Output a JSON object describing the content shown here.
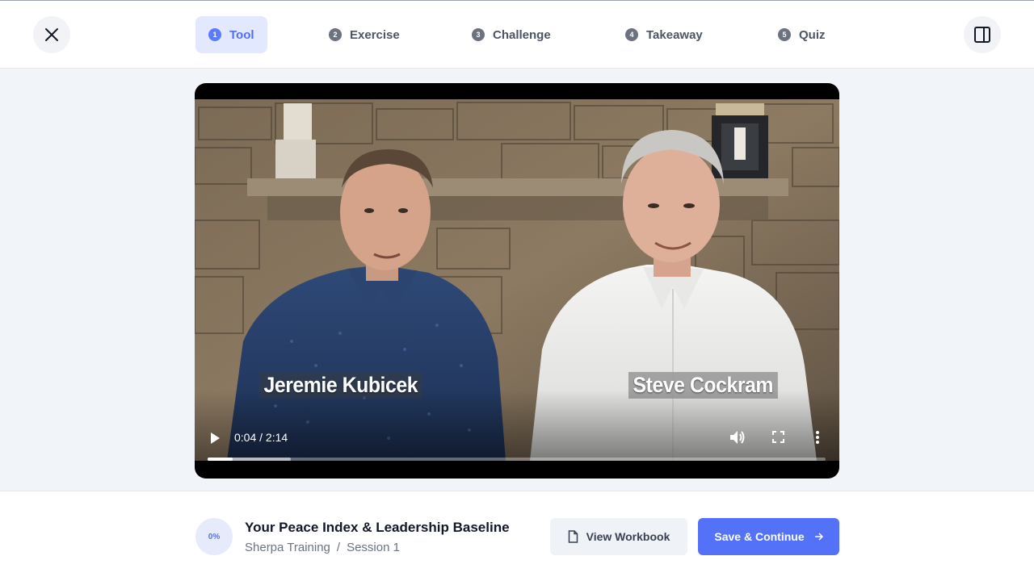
{
  "header": {
    "steps": [
      {
        "num": "1",
        "label": "Tool",
        "active": true
      },
      {
        "num": "2",
        "label": "Exercise",
        "active": false
      },
      {
        "num": "3",
        "label": "Challenge",
        "active": false
      },
      {
        "num": "4",
        "label": "Takeaway",
        "active": false
      },
      {
        "num": "5",
        "label": "Quiz",
        "active": false
      }
    ],
    "close_icon": "close-icon",
    "panel_icon": "sidebar-panel-icon"
  },
  "video": {
    "speaker_left": "Jeremie Kubicek",
    "speaker_right": "Steve Cockram",
    "time": "0:04 / 2:14",
    "progress_fraction": 0.04,
    "buffered_fraction": 0.135,
    "controls": [
      "play-icon",
      "volume-icon",
      "fullscreen-icon",
      "more-options-icon"
    ]
  },
  "footer": {
    "progress_percent": "0%",
    "lesson_title": "Your Peace Index & Leadership Baseline",
    "course": "Sherpa Training",
    "separator": "/",
    "session": "Session 1",
    "workbook_label": "View Workbook",
    "continue_label": "Save & Continue"
  },
  "colors": {
    "accent": "#5472f7",
    "active_step_bg": "#e2e8fd",
    "page_bg": "#f1f5f9"
  }
}
